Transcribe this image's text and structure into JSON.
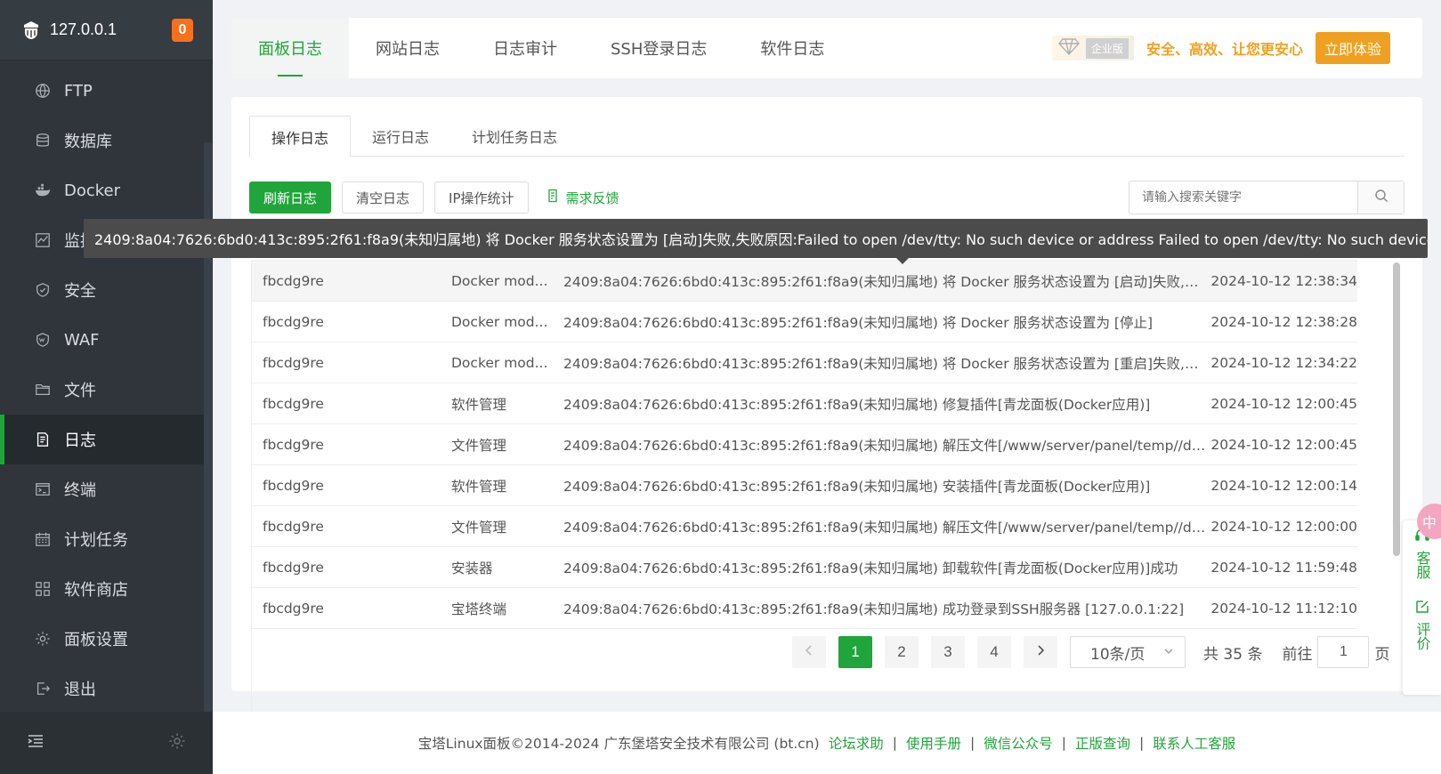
{
  "sidebar": {
    "ip": "127.0.0.1",
    "badge": "0",
    "items": [
      {
        "label": "FTP",
        "icon": "globe-icon"
      },
      {
        "label": "数据库",
        "icon": "database-icon"
      },
      {
        "label": "Docker",
        "icon": "docker-icon"
      },
      {
        "label": "监控",
        "icon": "monitor-icon"
      },
      {
        "label": "安全",
        "icon": "shield-icon"
      },
      {
        "label": "WAF",
        "icon": "waf-shield-icon"
      },
      {
        "label": "文件",
        "icon": "folder-icon"
      },
      {
        "label": "日志",
        "icon": "log-icon"
      },
      {
        "label": "终端",
        "icon": "terminal-icon"
      },
      {
        "label": "计划任务",
        "icon": "calendar-icon"
      },
      {
        "label": "软件商店",
        "icon": "grid-icon"
      },
      {
        "label": "面板设置",
        "icon": "gear-icon"
      },
      {
        "label": "退出",
        "icon": "logout-icon"
      }
    ]
  },
  "top_tabs": [
    "面板日志",
    "网站日志",
    "日志审计",
    "SSH登录日志",
    "软件日志"
  ],
  "enterprise": {
    "badge": "企业版",
    "slogan": "安全、高效、让您更安心",
    "button": "立即体验"
  },
  "sub_tabs": [
    "操作日志",
    "运行日志",
    "计划任务日志"
  ],
  "toolbar": {
    "refresh": "刷新日志",
    "clear": "清空日志",
    "ip_stats": "IP操作统计",
    "feedback": "需求反馈",
    "search_placeholder": "请输入搜索关键字"
  },
  "tooltip": "2409:8a04:7626:6bd0:413c:895:2f61:f8a9(未知归属地) 将 Docker 服务状态设置为 [启动]失败,失败原因:Failed to open /dev/tty: No such device or address Failed to open /dev/tty: No such device or address",
  "rows": [
    {
      "user": "fbcdg9re",
      "type": "Docker mod...",
      "detail": "2409:8a04:7626:6bd0:413c:895:2f61:f8a9(未知归属地) 将 Docker 服务状态设置为 [启动]失败,失败原因",
      "time": "2024-10-12 12:38:34"
    },
    {
      "user": "fbcdg9re",
      "type": "Docker mod...",
      "detail": "2409:8a04:7626:6bd0:413c:895:2f61:f8a9(未知归属地) 将 Docker 服务状态设置为 [停止]",
      "time": "2024-10-12 12:38:28"
    },
    {
      "user": "fbcdg9re",
      "type": "Docker mod...",
      "detail": "2409:8a04:7626:6bd0:413c:895:2f61:f8a9(未知归属地) 将 Docker 服务状态设置为 [重启]失败,失败原因",
      "time": "2024-10-12 12:34:22"
    },
    {
      "user": "fbcdg9re",
      "type": "软件管理",
      "detail": "2409:8a04:7626:6bd0:413c:895:2f61:f8a9(未知归属地) 修复插件[青龙面板(Docker应用)]",
      "time": "2024-10-12 12:00:45"
    },
    {
      "user": "fbcdg9re",
      "type": "文件管理",
      "detail": "2409:8a04:7626:6bd0:413c:895:2f61:f8a9(未知归属地) 解压文件[/www/server/panel/temp//dk_qing",
      "time": "2024-10-12 12:00:45"
    },
    {
      "user": "fbcdg9re",
      "type": "软件管理",
      "detail": "2409:8a04:7626:6bd0:413c:895:2f61:f8a9(未知归属地) 安装插件[青龙面板(Docker应用)]",
      "time": "2024-10-12 12:00:14"
    },
    {
      "user": "fbcdg9re",
      "type": "文件管理",
      "detail": "2409:8a04:7626:6bd0:413c:895:2f61:f8a9(未知归属地) 解压文件[/www/server/panel/temp//dk_qing",
      "time": "2024-10-12 12:00:00"
    },
    {
      "user": "fbcdg9re",
      "type": "安装器",
      "detail": "2409:8a04:7626:6bd0:413c:895:2f61:f8a9(未知归属地) 卸载软件[青龙面板(Docker应用)]成功",
      "time": "2024-10-12 11:59:48"
    },
    {
      "user": "fbcdg9re",
      "type": "宝塔终端",
      "detail": "2409:8a04:7626:6bd0:413c:895:2f61:f8a9(未知归属地) 成功登录到SSH服务器 [127.0.0.1:22]",
      "time": "2024-10-12 11:12:10"
    }
  ],
  "pagination": {
    "pages": [
      "1",
      "2",
      "3",
      "4"
    ],
    "page_size": "10条/页",
    "total": "共 35 条",
    "goto_label": "前往",
    "goto_value": "1",
    "unit": "页"
  },
  "float": {
    "bubble": "中",
    "service": "客服",
    "review": "评价"
  },
  "footer": {
    "copyright": "宝塔Linux面板©2014-2024 广东堡塔安全技术有限公司 (bt.cn)",
    "links": [
      "论坛求助",
      "使用手册",
      "微信公众号",
      "正版查询",
      "联系人工客服"
    ]
  },
  "colors": {
    "accent": "#20a53a",
    "sidebar_bg": "#2f353b",
    "enterprise": "#f0a020",
    "badge": "#f7711d"
  }
}
